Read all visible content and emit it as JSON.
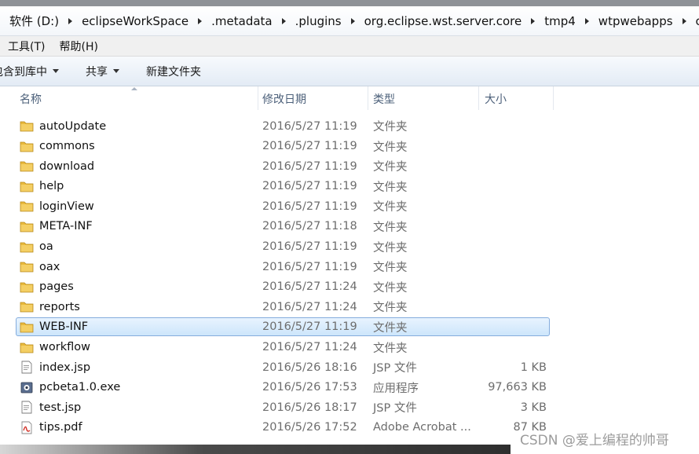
{
  "breadcrumb": [
    "软件 (D:)",
    "eclipseWorkSpace",
    ".metadata",
    ".plugins",
    "org.eclipse.wst.server.core",
    "tmp4",
    "wtpwebapps",
    "ccegp"
  ],
  "menubar": {
    "tools": "工具(T)",
    "help": "帮助(H)"
  },
  "toolbar": {
    "include_library": "包含到库中",
    "share": "共享",
    "new_folder": "新建文件夹"
  },
  "columns": {
    "name": "名称",
    "date": "修改日期",
    "type": "类型",
    "size": "大小"
  },
  "files": [
    {
      "name": "autoUpdate",
      "date": "2016/5/27 11:19",
      "type": "文件夹",
      "size": "",
      "icon": "folder-icon"
    },
    {
      "name": "commons",
      "date": "2016/5/27 11:19",
      "type": "文件夹",
      "size": "",
      "icon": "folder-icon"
    },
    {
      "name": "download",
      "date": "2016/5/27 11:19",
      "type": "文件夹",
      "size": "",
      "icon": "folder-icon"
    },
    {
      "name": "help",
      "date": "2016/5/27 11:19",
      "type": "文件夹",
      "size": "",
      "icon": "folder-icon"
    },
    {
      "name": "loginView",
      "date": "2016/5/27 11:19",
      "type": "文件夹",
      "size": "",
      "icon": "folder-icon"
    },
    {
      "name": "META-INF",
      "date": "2016/5/27 11:18",
      "type": "文件夹",
      "size": "",
      "icon": "folder-icon"
    },
    {
      "name": "oa",
      "date": "2016/5/27 11:19",
      "type": "文件夹",
      "size": "",
      "icon": "folder-icon"
    },
    {
      "name": "oax",
      "date": "2016/5/27 11:19",
      "type": "文件夹",
      "size": "",
      "icon": "folder-icon"
    },
    {
      "name": "pages",
      "date": "2016/5/27 11:24",
      "type": "文件夹",
      "size": "",
      "icon": "folder-icon"
    },
    {
      "name": "reports",
      "date": "2016/5/27 11:24",
      "type": "文件夹",
      "size": "",
      "icon": "folder-icon"
    },
    {
      "name": "WEB-INF",
      "date": "2016/5/27 11:19",
      "type": "文件夹",
      "size": "",
      "icon": "folder-icon",
      "selected": true
    },
    {
      "name": "workflow",
      "date": "2016/5/27 11:24",
      "type": "文件夹",
      "size": "",
      "icon": "folder-icon"
    },
    {
      "name": "index.jsp",
      "date": "2016/5/26 18:16",
      "type": "JSP 文件",
      "size": "1 KB",
      "icon": "jsp-file-icon"
    },
    {
      "name": "pcbeta1.0.exe",
      "date": "2016/5/26 17:53",
      "type": "应用程序",
      "size": "97,663 KB",
      "icon": "exe-file-icon"
    },
    {
      "name": "test.jsp",
      "date": "2016/5/26 18:17",
      "type": "JSP 文件",
      "size": "3 KB",
      "icon": "jsp-file-icon"
    },
    {
      "name": "tips.pdf",
      "date": "2016/5/26 17:52",
      "type": "Adobe Acrobat ...",
      "size": "87 KB",
      "icon": "pdf-file-icon"
    }
  ],
  "watermark": "CSDN @爱上编程的帅哥",
  "colors": {
    "selection_border": "#84acdd",
    "folder_yellow": "#e8b93d",
    "header_text": "#4c607a"
  }
}
